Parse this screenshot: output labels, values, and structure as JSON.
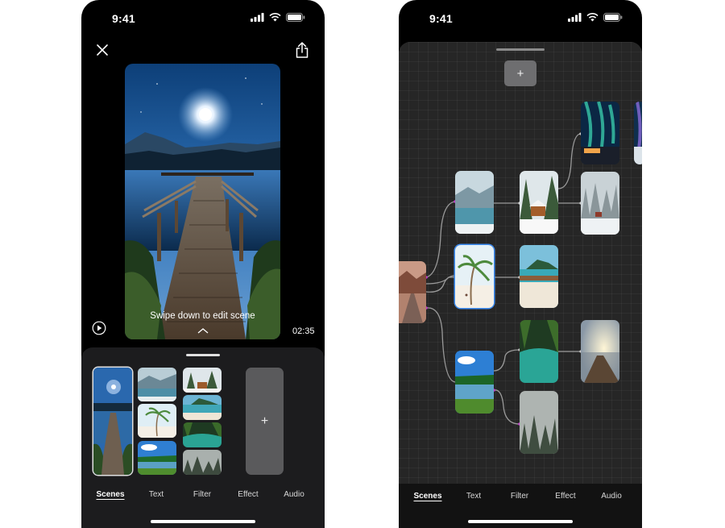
{
  "status_bar": {
    "time": "9:41",
    "icons": [
      "signal-icon",
      "wifi-icon",
      "battery-icon"
    ]
  },
  "editor": {
    "close_icon": "close-icon",
    "share_icon": "share-icon",
    "preview_caption": "Swipe down to edit scene",
    "play_icon": "play-icon",
    "duration": "02:35",
    "add_scene_label": "+",
    "scenes": [
      "Night pier",
      "Snowy lake",
      "Palm beach",
      "Green lake",
      "Snow cabin",
      "Tropical island",
      "Emerald river",
      "Misty forest"
    ]
  },
  "scene_graph": {
    "add_scene_label": "+"
  },
  "tabs": [
    "Scenes",
    "Text",
    "Filter",
    "Effect",
    "Audio"
  ],
  "active_tab": "Scenes",
  "colors": {
    "accent": "#3d8ef5",
    "link": "#9a9a9a",
    "connector_dot": "#c23ac9"
  }
}
